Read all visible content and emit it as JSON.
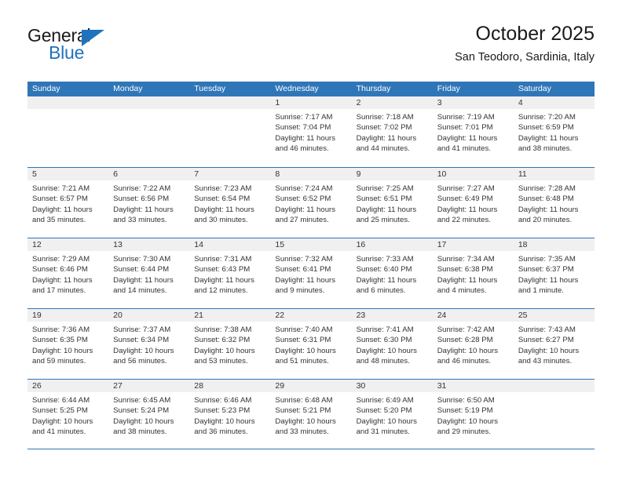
{
  "brand": {
    "name_part1": "General",
    "name_part2": "Blue",
    "triangle_color": "#1f72bd"
  },
  "header": {
    "title": "October 2025",
    "subtitle": "San Teodoro, Sardinia, Italy"
  },
  "theme": {
    "accent": "#2f76b8",
    "day_strip": "#f0f0f0",
    "text": "#333333"
  },
  "weekdays": [
    "Sunday",
    "Monday",
    "Tuesday",
    "Wednesday",
    "Thursday",
    "Friday",
    "Saturday"
  ],
  "labels": {
    "sunrise_prefix": "Sunrise:",
    "sunset_prefix": "Sunset:",
    "daylight_prefix": "Daylight:"
  },
  "weeks": [
    [
      {
        "day": "",
        "empty": true
      },
      {
        "day": "",
        "empty": true
      },
      {
        "day": "",
        "empty": true
      },
      {
        "day": "1",
        "sunrise": "Sunrise: 7:17 AM",
        "sunset": "Sunset: 7:04 PM",
        "daylight_l1": "Daylight: 11 hours",
        "daylight_l2": "and 46 minutes."
      },
      {
        "day": "2",
        "sunrise": "Sunrise: 7:18 AM",
        "sunset": "Sunset: 7:02 PM",
        "daylight_l1": "Daylight: 11 hours",
        "daylight_l2": "and 44 minutes."
      },
      {
        "day": "3",
        "sunrise": "Sunrise: 7:19 AM",
        "sunset": "Sunset: 7:01 PM",
        "daylight_l1": "Daylight: 11 hours",
        "daylight_l2": "and 41 minutes."
      },
      {
        "day": "4",
        "sunrise": "Sunrise: 7:20 AM",
        "sunset": "Sunset: 6:59 PM",
        "daylight_l1": "Daylight: 11 hours",
        "daylight_l2": "and 38 minutes."
      }
    ],
    [
      {
        "day": "5",
        "sunrise": "Sunrise: 7:21 AM",
        "sunset": "Sunset: 6:57 PM",
        "daylight_l1": "Daylight: 11 hours",
        "daylight_l2": "and 35 minutes."
      },
      {
        "day": "6",
        "sunrise": "Sunrise: 7:22 AM",
        "sunset": "Sunset: 6:56 PM",
        "daylight_l1": "Daylight: 11 hours",
        "daylight_l2": "and 33 minutes."
      },
      {
        "day": "7",
        "sunrise": "Sunrise: 7:23 AM",
        "sunset": "Sunset: 6:54 PM",
        "daylight_l1": "Daylight: 11 hours",
        "daylight_l2": "and 30 minutes."
      },
      {
        "day": "8",
        "sunrise": "Sunrise: 7:24 AM",
        "sunset": "Sunset: 6:52 PM",
        "daylight_l1": "Daylight: 11 hours",
        "daylight_l2": "and 27 minutes."
      },
      {
        "day": "9",
        "sunrise": "Sunrise: 7:25 AM",
        "sunset": "Sunset: 6:51 PM",
        "daylight_l1": "Daylight: 11 hours",
        "daylight_l2": "and 25 minutes."
      },
      {
        "day": "10",
        "sunrise": "Sunrise: 7:27 AM",
        "sunset": "Sunset: 6:49 PM",
        "daylight_l1": "Daylight: 11 hours",
        "daylight_l2": "and 22 minutes."
      },
      {
        "day": "11",
        "sunrise": "Sunrise: 7:28 AM",
        "sunset": "Sunset: 6:48 PM",
        "daylight_l1": "Daylight: 11 hours",
        "daylight_l2": "and 20 minutes."
      }
    ],
    [
      {
        "day": "12",
        "sunrise": "Sunrise: 7:29 AM",
        "sunset": "Sunset: 6:46 PM",
        "daylight_l1": "Daylight: 11 hours",
        "daylight_l2": "and 17 minutes."
      },
      {
        "day": "13",
        "sunrise": "Sunrise: 7:30 AM",
        "sunset": "Sunset: 6:44 PM",
        "daylight_l1": "Daylight: 11 hours",
        "daylight_l2": "and 14 minutes."
      },
      {
        "day": "14",
        "sunrise": "Sunrise: 7:31 AM",
        "sunset": "Sunset: 6:43 PM",
        "daylight_l1": "Daylight: 11 hours",
        "daylight_l2": "and 12 minutes."
      },
      {
        "day": "15",
        "sunrise": "Sunrise: 7:32 AM",
        "sunset": "Sunset: 6:41 PM",
        "daylight_l1": "Daylight: 11 hours",
        "daylight_l2": "and 9 minutes."
      },
      {
        "day": "16",
        "sunrise": "Sunrise: 7:33 AM",
        "sunset": "Sunset: 6:40 PM",
        "daylight_l1": "Daylight: 11 hours",
        "daylight_l2": "and 6 minutes."
      },
      {
        "day": "17",
        "sunrise": "Sunrise: 7:34 AM",
        "sunset": "Sunset: 6:38 PM",
        "daylight_l1": "Daylight: 11 hours",
        "daylight_l2": "and 4 minutes."
      },
      {
        "day": "18",
        "sunrise": "Sunrise: 7:35 AM",
        "sunset": "Sunset: 6:37 PM",
        "daylight_l1": "Daylight: 11 hours",
        "daylight_l2": "and 1 minute."
      }
    ],
    [
      {
        "day": "19",
        "sunrise": "Sunrise: 7:36 AM",
        "sunset": "Sunset: 6:35 PM",
        "daylight_l1": "Daylight: 10 hours",
        "daylight_l2": "and 59 minutes."
      },
      {
        "day": "20",
        "sunrise": "Sunrise: 7:37 AM",
        "sunset": "Sunset: 6:34 PM",
        "daylight_l1": "Daylight: 10 hours",
        "daylight_l2": "and 56 minutes."
      },
      {
        "day": "21",
        "sunrise": "Sunrise: 7:38 AM",
        "sunset": "Sunset: 6:32 PM",
        "daylight_l1": "Daylight: 10 hours",
        "daylight_l2": "and 53 minutes."
      },
      {
        "day": "22",
        "sunrise": "Sunrise: 7:40 AM",
        "sunset": "Sunset: 6:31 PM",
        "daylight_l1": "Daylight: 10 hours",
        "daylight_l2": "and 51 minutes."
      },
      {
        "day": "23",
        "sunrise": "Sunrise: 7:41 AM",
        "sunset": "Sunset: 6:30 PM",
        "daylight_l1": "Daylight: 10 hours",
        "daylight_l2": "and 48 minutes."
      },
      {
        "day": "24",
        "sunrise": "Sunrise: 7:42 AM",
        "sunset": "Sunset: 6:28 PM",
        "daylight_l1": "Daylight: 10 hours",
        "daylight_l2": "and 46 minutes."
      },
      {
        "day": "25",
        "sunrise": "Sunrise: 7:43 AM",
        "sunset": "Sunset: 6:27 PM",
        "daylight_l1": "Daylight: 10 hours",
        "daylight_l2": "and 43 minutes."
      }
    ],
    [
      {
        "day": "26",
        "sunrise": "Sunrise: 6:44 AM",
        "sunset": "Sunset: 5:25 PM",
        "daylight_l1": "Daylight: 10 hours",
        "daylight_l2": "and 41 minutes."
      },
      {
        "day": "27",
        "sunrise": "Sunrise: 6:45 AM",
        "sunset": "Sunset: 5:24 PM",
        "daylight_l1": "Daylight: 10 hours",
        "daylight_l2": "and 38 minutes."
      },
      {
        "day": "28",
        "sunrise": "Sunrise: 6:46 AM",
        "sunset": "Sunset: 5:23 PM",
        "daylight_l1": "Daylight: 10 hours",
        "daylight_l2": "and 36 minutes."
      },
      {
        "day": "29",
        "sunrise": "Sunrise: 6:48 AM",
        "sunset": "Sunset: 5:21 PM",
        "daylight_l1": "Daylight: 10 hours",
        "daylight_l2": "and 33 minutes."
      },
      {
        "day": "30",
        "sunrise": "Sunrise: 6:49 AM",
        "sunset": "Sunset: 5:20 PM",
        "daylight_l1": "Daylight: 10 hours",
        "daylight_l2": "and 31 minutes."
      },
      {
        "day": "31",
        "sunrise": "Sunrise: 6:50 AM",
        "sunset": "Sunset: 5:19 PM",
        "daylight_l1": "Daylight: 10 hours",
        "daylight_l2": "and 29 minutes."
      },
      {
        "day": "",
        "empty": true
      }
    ]
  ]
}
